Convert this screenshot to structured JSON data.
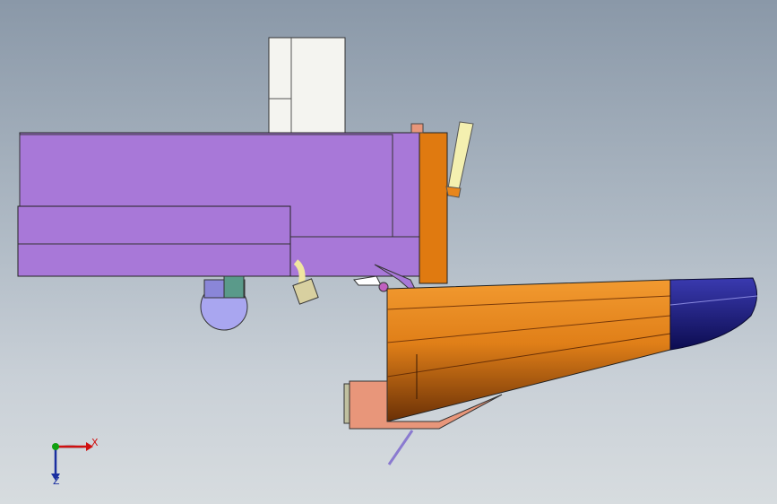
{
  "viewport": {
    "type": "cad-3d-model-view",
    "background_top": "#8a98a8",
    "background_bottom": "#d7dcdf"
  },
  "triad": {
    "x_label": "X",
    "z_label": "Z",
    "x_color": "#d01010",
    "y_color": "#10a010",
    "z_color": "#1a2fa0"
  },
  "parts": {
    "tower_color": "#f2f2ee",
    "frame_color": "#a878d8",
    "plate_color": "#e07a10",
    "hull_color": "#e8861c",
    "bow_color": "#2a2a8a",
    "bracket_color": "#e8967a",
    "roller_color": "#a9a6f0",
    "hose_color": "#f0e6a0",
    "arm_color": "#f4f0b0"
  }
}
